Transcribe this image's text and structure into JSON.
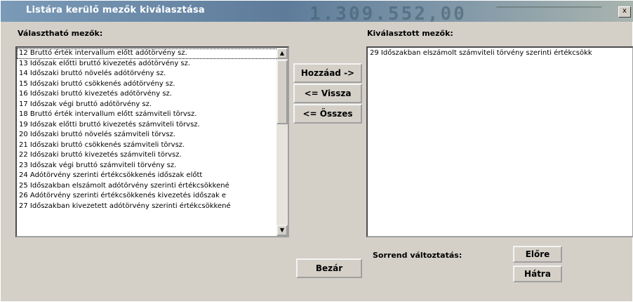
{
  "window": {
    "title": "Listára kerülő mezők kiválasztása",
    "watermark": "1.309.552,00",
    "close_glyph": "x"
  },
  "available": {
    "label": "Választható mezők:",
    "items": [
      "12  Bruttó érték intervallum előtt adótörvény sz.",
      "13  Időszak előtti bruttó kivezetés adótörvény sz.",
      "14  Időszaki bruttó növelés adótörvény sz.",
      "15  Időszaki bruttó csökkenés adótörvény sz.",
      "16  Időszaki bruttó kivezetés adótörvény sz.",
      "17  Időszak végi bruttó adótörvény sz.",
      "18  Bruttó érték intervallum előtt számviteli törvsz.",
      "19  Időszak előtti bruttó kivezetés számviteli törvsz.",
      "20  Időszaki bruttó növelés számviteli törvsz.",
      "21  Időszaki bruttó csökkenés számviteli törvsz.",
      "22  Időszaki bruttó kivezetés számviteli törvsz.",
      "23  Időszak végi bruttó számviteli törvény sz.",
      "24  Adótörvény szerinti értékcsökkenés időszak előtt",
      "25  Időszakban elszámolt adótörvény szerinti értékcsökkené",
      "26  Adótörvény szerinti értékcsökkenés kivezetés időszak e",
      "27  Időszakban kivezetett adótörvény szerinti értékcsökkené"
    ]
  },
  "selected": {
    "label": "Kiválasztott mezők:",
    "items": [
      "29  Időszakban elszámolt számviteli törvény szerinti értékcsökk"
    ]
  },
  "buttons": {
    "add": "Hozzáad ->",
    "back": "<= Vissza",
    "all": "<= Összes",
    "close": "Bezár",
    "forward": "Előre",
    "backward": "Hátra"
  },
  "order_label": "Sorrend változtatás:",
  "icons": {
    "scroll_up": "▲",
    "scroll_down": "▼"
  }
}
